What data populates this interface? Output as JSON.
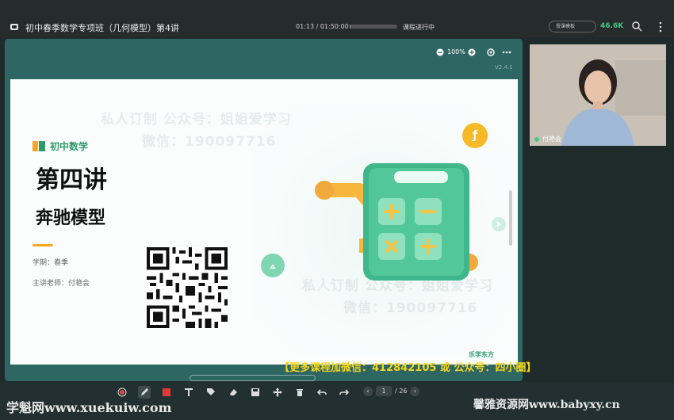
{
  "header": {
    "title": "初中春季数学专项班（几何模型）第4讲",
    "time": "01:13 / 01:50:00",
    "progress": 0.01,
    "status": "课程进行中",
    "pill": "授课模板",
    "speed": "46.6K"
  },
  "slide_toolbar": {
    "zoom": "100%",
    "version": "V2.4.1"
  },
  "slide": {
    "brand": "初中数学",
    "lecture": "第四讲",
    "topic": "奔驰模型",
    "term": "学期：春季",
    "teacher": "主讲老师：付艳会",
    "watermark_line1": "私人订制 公众号：姐姐爱学习",
    "watermark_line2": "微信：19009771​6",
    "watermark_line3": "私人订制 公众号：姐姐爱学习",
    "watermark_line4": "微信：190097716",
    "logo": "乐学东方"
  },
  "banner": "【更多课程加微信：412842105 或 公众号：四小圈】",
  "pager": {
    "current": "1",
    "total": "/ 26"
  },
  "watermarks": {
    "left": "学魁网www.xuekuiw.com",
    "right": "馨雅资源网www.babyxy.cn"
  },
  "video": {
    "name": "付艳会"
  },
  "colors": {
    "accent": "#2f9a6a",
    "orange": "#f5a623",
    "banner": "#f2d61f"
  }
}
